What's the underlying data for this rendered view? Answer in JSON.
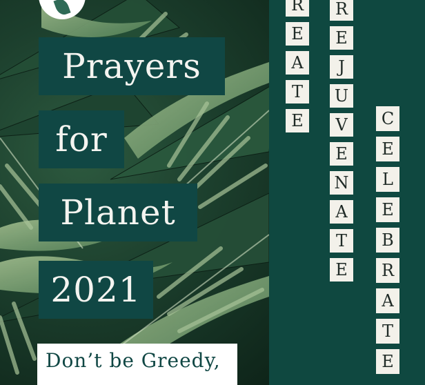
{
  "poster": {
    "title_lines": [
      "Prayers",
      "for",
      "Planet",
      "2021"
    ],
    "tagline": "Don’t be Greedy,"
  },
  "columns": {
    "create_visible": [
      "R",
      "E",
      "A",
      "T",
      "E"
    ],
    "rejuvenate": [
      "R",
      "E",
      "J",
      "U",
      "V",
      "E",
      "N",
      "A",
      "T",
      "E"
    ],
    "celebrate": [
      "C",
      "E",
      "L",
      "E",
      "B",
      "R",
      "A",
      "T",
      "E"
    ]
  },
  "colors": {
    "panel": "#0f4840",
    "title_box": "#104744",
    "tile": "#f3f1ea",
    "leaf_dark": "#1f4a33",
    "leaf_light": "#7fa277"
  },
  "icons": {
    "logo": "leaf-logo-icon"
  }
}
